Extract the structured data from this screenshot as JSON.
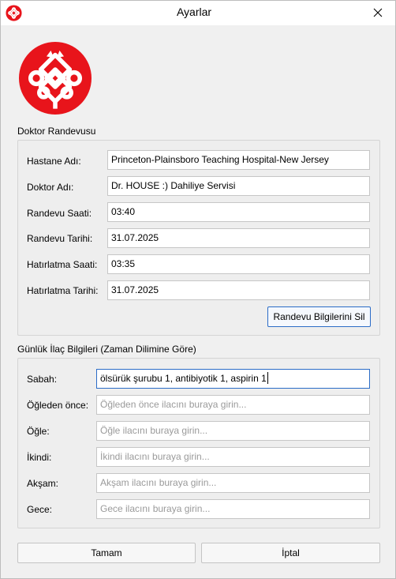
{
  "window": {
    "title": "Ayarlar"
  },
  "appointment": {
    "group_title": "Doktor Randevusu",
    "fields": [
      {
        "label": "Hastane Adı:",
        "value": "Princeton-Plainsboro Teaching Hospital-New Jersey"
      },
      {
        "label": "Doktor Adı:",
        "value": "Dr. HOUSE :) Dahiliye Servisi"
      },
      {
        "label": "Randevu Saati:",
        "value": "03:40"
      },
      {
        "label": "Randevu Tarihi:",
        "value": "31.07.2025"
      },
      {
        "label": "Hatırlatma Saati:",
        "value": "03:35"
      },
      {
        "label": "Hatırlatma Tarihi:",
        "value": "31.07.2025"
      }
    ],
    "delete_button": "Randevu Bilgilerini Sil"
  },
  "medication": {
    "group_title": "Günlük İlaç Bilgileri (Zaman Dilimine Göre)",
    "fields": [
      {
        "label": "Sabah:",
        "value": "ölsürük şurubu 1, antibiyotik 1, aspirin 1",
        "placeholder": ""
      },
      {
        "label": "Öğleden önce:",
        "value": "",
        "placeholder": "Öğleden önce ilacını buraya girin..."
      },
      {
        "label": "Öğle:",
        "value": "",
        "placeholder": "Öğle ilacını buraya girin..."
      },
      {
        "label": "İkindi:",
        "value": "",
        "placeholder": "İkindi ilacını buraya girin..."
      },
      {
        "label": "Akşam:",
        "value": "",
        "placeholder": "Akşam ilacını buraya girin..."
      },
      {
        "label": "Gece:",
        "value": "",
        "placeholder": "Gece ilacını buraya girin..."
      }
    ]
  },
  "footer": {
    "ok_button": "Tamam",
    "cancel_button": "İptal"
  },
  "colors": {
    "logo_red": "#e8141b",
    "focus_blue": "#2b6cc7"
  }
}
